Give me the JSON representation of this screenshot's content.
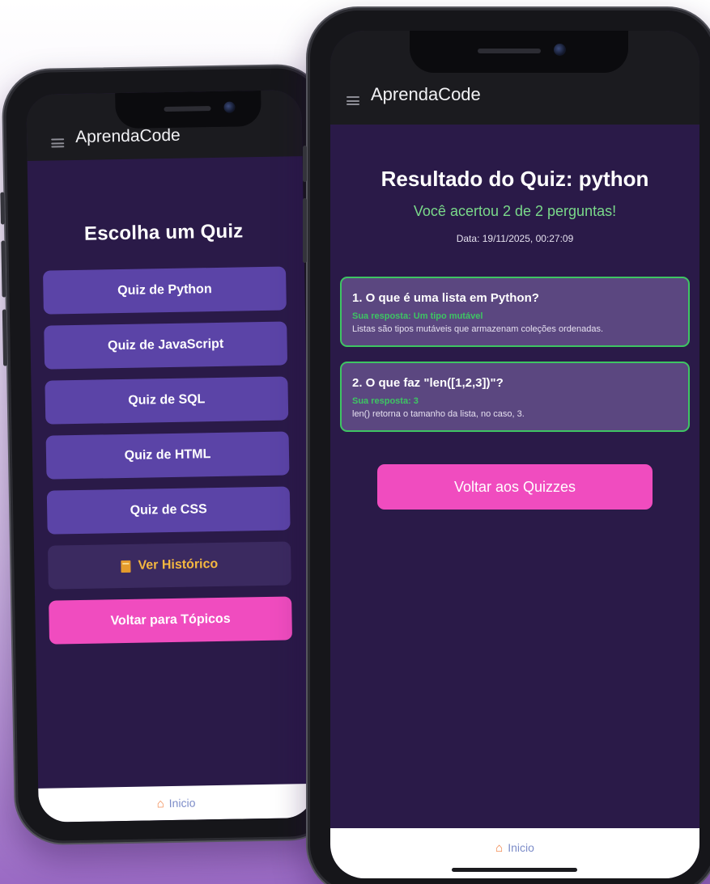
{
  "app": {
    "name": "AprendaCode"
  },
  "back_screen": {
    "heading": "Escolha um Quiz",
    "quizzes": [
      "Quiz de Python",
      "Quiz de JavaScript",
      "Quiz de SQL",
      "Quiz de HTML",
      "Quiz de CSS"
    ],
    "history_label": "Ver Histórico",
    "back_label": "Voltar para Tópicos",
    "nav_home": "Inicio"
  },
  "front_screen": {
    "title": "Resultado do Quiz: python",
    "score_text": "Você acertou 2 de 2 perguntas!",
    "date_text": "Data: 19/11/2025, 00:27:09",
    "answers": [
      {
        "question": "1. O que é uma lista em Python?",
        "your_answer": "Sua resposta: Um tipo mutável",
        "explanation": "Listas são tipos mutáveis que armazenam coleções ordenadas."
      },
      {
        "question": "2. O que faz \"len([1,2,3])\"?",
        "your_answer": "Sua resposta: 3",
        "explanation": "len() retorna o tamanho da lista, no caso, 3."
      }
    ],
    "back_label": "Voltar aos Quizzes",
    "nav_home": "Inicio"
  },
  "colors": {
    "screen_bg": "#2a1a48",
    "quiz_button": "#5b44a7",
    "accent_pink": "#f04cbf",
    "success_green": "#3ec563",
    "history_gold": "#f4b740"
  },
  "icons": {
    "menu": "hamburger-menu-icon",
    "history": "book-icon",
    "home": "home-icon"
  }
}
